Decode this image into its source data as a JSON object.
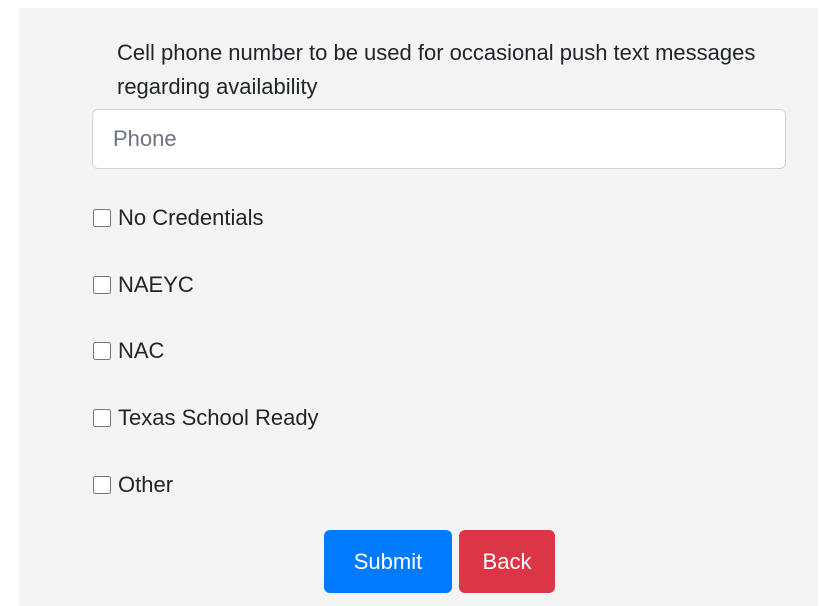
{
  "form": {
    "phone_label": "Cell phone number to be used for occasional push text messages regarding availability",
    "phone_placeholder": "Phone",
    "phone_value": "",
    "credentials": [
      {
        "label": "No Credentials",
        "checked": false
      },
      {
        "label": "NAEYC",
        "checked": false
      },
      {
        "label": "NAC",
        "checked": false
      },
      {
        "label": "Texas School Ready",
        "checked": false
      },
      {
        "label": "Other",
        "checked": false
      }
    ],
    "submit_label": "Submit",
    "back_label": "Back"
  },
  "colors": {
    "panel_bg": "#f4f4f4",
    "submit": "#007bff",
    "back": "#dc3545"
  }
}
